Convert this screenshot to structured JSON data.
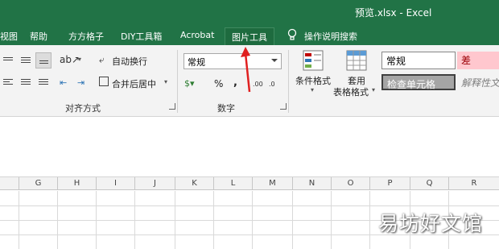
{
  "window": {
    "title": "预览.xlsx - Excel"
  },
  "tabs": [
    {
      "label": "视图"
    },
    {
      "label": "帮助"
    },
    {
      "label": "方方格子"
    },
    {
      "label": "DIY工具箱"
    },
    {
      "label": "Acrobat"
    },
    {
      "label": "图片工具"
    },
    {
      "label": "操作说明搜索"
    }
  ],
  "ribbon": {
    "wrap_text": "自动换行",
    "merge_center": "合并后居中",
    "alignment_group": "对齐方式",
    "number_format_value": "常规",
    "percent": "%",
    "comma": ",",
    "number_group": "数字",
    "conditional_format": "条件格式",
    "format_as_table_line1": "套用",
    "format_as_table_line2": "表格格式",
    "style_normal": "常规",
    "style_bad": "差",
    "style_check_cell": "检查单元格",
    "style_explanatory": "解释性文"
  },
  "columns": [
    "F",
    "G",
    "H",
    "I",
    "J",
    "K",
    "L",
    "M",
    "N",
    "O",
    "P",
    "Q",
    "R"
  ],
  "watermark": "易坊好文馆",
  "colors": {
    "excel_green": "#217346",
    "bad_fill": "#ffc7ce",
    "bad_text": "#9c0006",
    "annotation_arrow": "#e02020"
  }
}
